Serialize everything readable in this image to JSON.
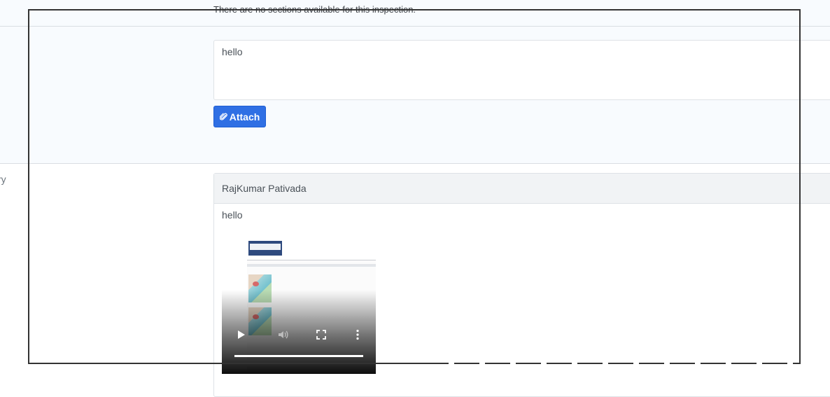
{
  "top_notice": "There are no sections available for this inspection.",
  "comment": {
    "value": "hello"
  },
  "attach_label": "Attach",
  "sidebar_label": "ry",
  "history": {
    "author": "RajKumar Pativada",
    "message": "hello"
  },
  "video": {
    "progress": 1.0
  }
}
